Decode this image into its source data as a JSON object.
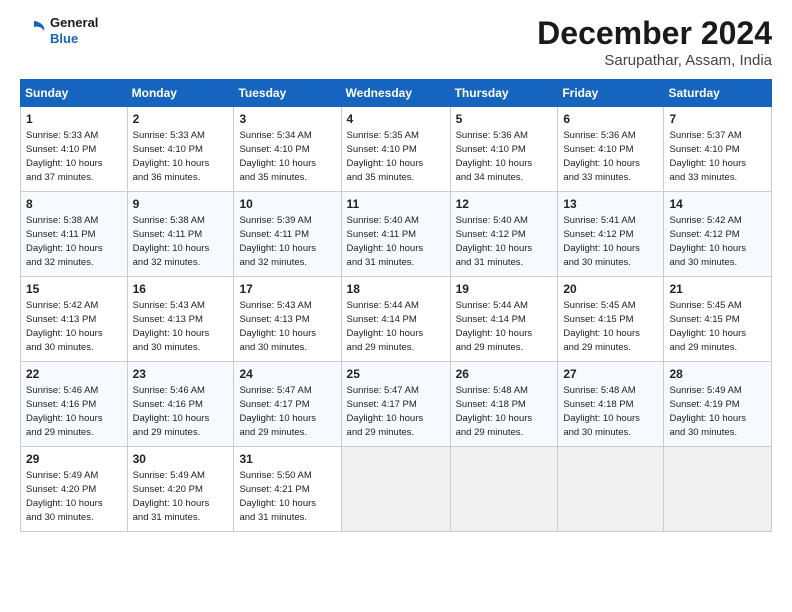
{
  "logo": {
    "line1": "General",
    "line2": "Blue"
  },
  "title": "December 2024",
  "location": "Sarupathar, Assam, India",
  "days_of_week": [
    "Sunday",
    "Monday",
    "Tuesday",
    "Wednesday",
    "Thursday",
    "Friday",
    "Saturday"
  ],
  "weeks": [
    [
      {
        "day": "1",
        "info": "Sunrise: 5:33 AM\nSunset: 4:10 PM\nDaylight: 10 hours\nand 37 minutes."
      },
      {
        "day": "2",
        "info": "Sunrise: 5:33 AM\nSunset: 4:10 PM\nDaylight: 10 hours\nand 36 minutes."
      },
      {
        "day": "3",
        "info": "Sunrise: 5:34 AM\nSunset: 4:10 PM\nDaylight: 10 hours\nand 35 minutes."
      },
      {
        "day": "4",
        "info": "Sunrise: 5:35 AM\nSunset: 4:10 PM\nDaylight: 10 hours\nand 35 minutes."
      },
      {
        "day": "5",
        "info": "Sunrise: 5:36 AM\nSunset: 4:10 PM\nDaylight: 10 hours\nand 34 minutes."
      },
      {
        "day": "6",
        "info": "Sunrise: 5:36 AM\nSunset: 4:10 PM\nDaylight: 10 hours\nand 33 minutes."
      },
      {
        "day": "7",
        "info": "Sunrise: 5:37 AM\nSunset: 4:10 PM\nDaylight: 10 hours\nand 33 minutes."
      }
    ],
    [
      {
        "day": "8",
        "info": "Sunrise: 5:38 AM\nSunset: 4:11 PM\nDaylight: 10 hours\nand 32 minutes."
      },
      {
        "day": "9",
        "info": "Sunrise: 5:38 AM\nSunset: 4:11 PM\nDaylight: 10 hours\nand 32 minutes."
      },
      {
        "day": "10",
        "info": "Sunrise: 5:39 AM\nSunset: 4:11 PM\nDaylight: 10 hours\nand 32 minutes."
      },
      {
        "day": "11",
        "info": "Sunrise: 5:40 AM\nSunset: 4:11 PM\nDaylight: 10 hours\nand 31 minutes."
      },
      {
        "day": "12",
        "info": "Sunrise: 5:40 AM\nSunset: 4:12 PM\nDaylight: 10 hours\nand 31 minutes."
      },
      {
        "day": "13",
        "info": "Sunrise: 5:41 AM\nSunset: 4:12 PM\nDaylight: 10 hours\nand 30 minutes."
      },
      {
        "day": "14",
        "info": "Sunrise: 5:42 AM\nSunset: 4:12 PM\nDaylight: 10 hours\nand 30 minutes."
      }
    ],
    [
      {
        "day": "15",
        "info": "Sunrise: 5:42 AM\nSunset: 4:13 PM\nDaylight: 10 hours\nand 30 minutes."
      },
      {
        "day": "16",
        "info": "Sunrise: 5:43 AM\nSunset: 4:13 PM\nDaylight: 10 hours\nand 30 minutes."
      },
      {
        "day": "17",
        "info": "Sunrise: 5:43 AM\nSunset: 4:13 PM\nDaylight: 10 hours\nand 30 minutes."
      },
      {
        "day": "18",
        "info": "Sunrise: 5:44 AM\nSunset: 4:14 PM\nDaylight: 10 hours\nand 29 minutes."
      },
      {
        "day": "19",
        "info": "Sunrise: 5:44 AM\nSunset: 4:14 PM\nDaylight: 10 hours\nand 29 minutes."
      },
      {
        "day": "20",
        "info": "Sunrise: 5:45 AM\nSunset: 4:15 PM\nDaylight: 10 hours\nand 29 minutes."
      },
      {
        "day": "21",
        "info": "Sunrise: 5:45 AM\nSunset: 4:15 PM\nDaylight: 10 hours\nand 29 minutes."
      }
    ],
    [
      {
        "day": "22",
        "info": "Sunrise: 5:46 AM\nSunset: 4:16 PM\nDaylight: 10 hours\nand 29 minutes."
      },
      {
        "day": "23",
        "info": "Sunrise: 5:46 AM\nSunset: 4:16 PM\nDaylight: 10 hours\nand 29 minutes."
      },
      {
        "day": "24",
        "info": "Sunrise: 5:47 AM\nSunset: 4:17 PM\nDaylight: 10 hours\nand 29 minutes."
      },
      {
        "day": "25",
        "info": "Sunrise: 5:47 AM\nSunset: 4:17 PM\nDaylight: 10 hours\nand 29 minutes."
      },
      {
        "day": "26",
        "info": "Sunrise: 5:48 AM\nSunset: 4:18 PM\nDaylight: 10 hours\nand 29 minutes."
      },
      {
        "day": "27",
        "info": "Sunrise: 5:48 AM\nSunset: 4:18 PM\nDaylight: 10 hours\nand 30 minutes."
      },
      {
        "day": "28",
        "info": "Sunrise: 5:49 AM\nSunset: 4:19 PM\nDaylight: 10 hours\nand 30 minutes."
      }
    ],
    [
      {
        "day": "29",
        "info": "Sunrise: 5:49 AM\nSunset: 4:20 PM\nDaylight: 10 hours\nand 30 minutes."
      },
      {
        "day": "30",
        "info": "Sunrise: 5:49 AM\nSunset: 4:20 PM\nDaylight: 10 hours\nand 31 minutes."
      },
      {
        "day": "31",
        "info": "Sunrise: 5:50 AM\nSunset: 4:21 PM\nDaylight: 10 hours\nand 31 minutes."
      },
      null,
      null,
      null,
      null
    ]
  ]
}
